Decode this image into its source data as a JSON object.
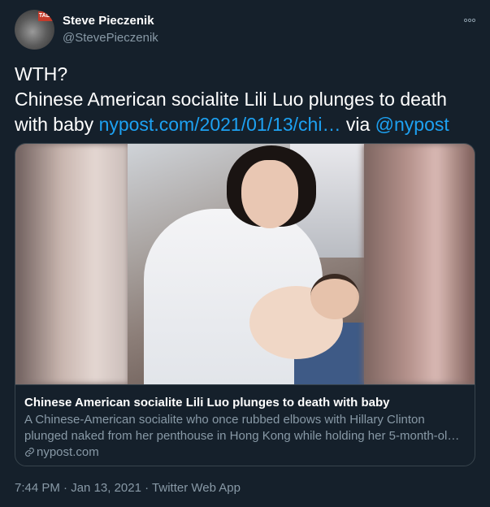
{
  "author": {
    "name": "Steve Pieczenik",
    "handle": "@StevePieczenik",
    "avatar_tag": "TALK"
  },
  "more_icon": "more-horizontal-icon",
  "tweet": {
    "line1": "WTH?",
    "line2": "Chinese American socialite Lili Luo plunges to death",
    "line3_prefix": "with baby ",
    "url_text": "nypost.com/2021/01/13/chi…",
    "via_text": " via ",
    "mention": "@nypost"
  },
  "card": {
    "title": "Chinese American socialite Lili Luo plunges to death with baby",
    "description_line1": "A Chinese-American socialite who once rubbed elbows with Hillary Clinton",
    "description_line2": "plunged naked from her penthouse in Hong Kong while holding her 5-month-ol…",
    "domain": "nypost.com"
  },
  "meta": {
    "time": "7:44 PM",
    "separator1": " · ",
    "date": "Jan 13, 2021",
    "separator2": " · ",
    "source": "Twitter Web App"
  },
  "colors": {
    "background": "#15202b",
    "link": "#1da1f2",
    "secondary_text": "#8899a6",
    "border": "#38444d"
  }
}
